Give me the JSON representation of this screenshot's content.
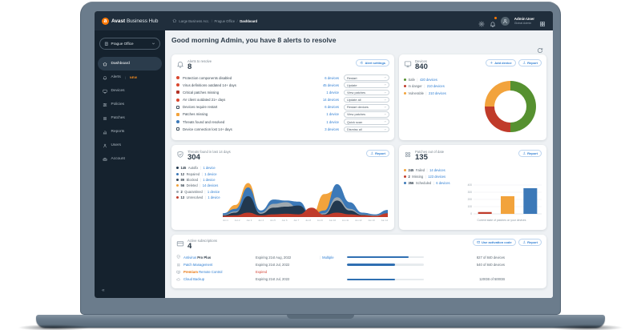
{
  "topbar": {
    "brand_bold": "Avast",
    "brand_rest": "Business Hub",
    "breadcrumb": [
      "Large Business Acc.",
      "Prague Office",
      "Dashboard"
    ],
    "user_name": "Admin User",
    "user_role": "Global Admin"
  },
  "sidebar": {
    "org": "Prague Office",
    "items": [
      {
        "label": "Dashboard",
        "icon": "home-icon",
        "active": true
      },
      {
        "label": "Alerts",
        "icon": "bell-icon",
        "badge": "NEW"
      },
      {
        "label": "Devices",
        "icon": "monitor-icon"
      },
      {
        "label": "Policies",
        "icon": "sliders-icon"
      },
      {
        "label": "Patches",
        "icon": "patch-icon"
      },
      {
        "label": "Reports",
        "icon": "report-icon"
      },
      {
        "label": "Users",
        "icon": "user-icon"
      },
      {
        "label": "Account",
        "icon": "case-icon"
      }
    ]
  },
  "main": {
    "greeting": "Good morning Admin, you have 8 alerts to resolve"
  },
  "alerts_card": {
    "title": "Alerts to resolve",
    "count": "8",
    "settings_button": "Alert settings",
    "rows": [
      {
        "label": "Protection components disabled",
        "devices": "6 devices",
        "action": "Restart",
        "icon": "circle",
        "color": "#d9472f"
      },
      {
        "label": "Virus definitions outdated 14+ days",
        "devices": "45 devices",
        "action": "Update",
        "icon": "circle",
        "color": "#d9472f"
      },
      {
        "label": "Critical patches missing",
        "devices": "1 device",
        "action": "View patches",
        "icon": "square",
        "color": "#b23327"
      },
      {
        "label": "AV client outdated 21+ days",
        "devices": "14 devices",
        "action": "Update all",
        "icon": "circle",
        "color": "#d9472f"
      },
      {
        "label": "Devices require restart",
        "devices": "6 devices",
        "action": "Restart devices",
        "icon": "outline",
        "color": "#3d4f5e"
      },
      {
        "label": "Patches missing",
        "devices": "1 device",
        "action": "View patches",
        "icon": "square",
        "color": "#f2a33c"
      },
      {
        "label": "Threats found and resolved",
        "devices": "1 device",
        "action": "Quick scan",
        "icon": "circle",
        "color": "#3c79b8"
      },
      {
        "label": "Device connection lost 14+ days",
        "devices": "3 devices",
        "action": "Dismiss all",
        "icon": "outline",
        "color": "#3d4f5e"
      }
    ]
  },
  "devices_card": {
    "title": "Devices",
    "count": "840",
    "add_button": "Add device",
    "report_button": "Report",
    "legend": [
      {
        "label": "Safe",
        "value": "420 devices",
        "color": "#569130"
      },
      {
        "label": "In danger",
        "value": "210 devices",
        "color": "#c03b2a"
      },
      {
        "label": "Vulnerable",
        "value": "210 devices",
        "color": "#f2a33c"
      }
    ]
  },
  "threats_card": {
    "title": "Threats found in last 14 days",
    "count": "304",
    "report_button": "Report",
    "legend": [
      {
        "num": "145",
        "label": "Autofix",
        "value": "1 device",
        "color": "#22384e"
      },
      {
        "num": "12",
        "label": "Repaired",
        "value": "1 device",
        "color": "#3c79b8"
      },
      {
        "num": "89",
        "label": "Blocked",
        "value": "1 device",
        "color": "#31465c"
      },
      {
        "num": "56",
        "label": "Deleted",
        "value": "14 devices",
        "color": "#f2a33c"
      },
      {
        "num": "2",
        "label": "Quarantined",
        "value": "1 device",
        "color": "#9fa9b0"
      },
      {
        "num": "13",
        "label": "Unresolved",
        "value": "1 device",
        "color": "#c03b2a"
      }
    ]
  },
  "patches_card": {
    "title": "Patches out of date",
    "count": "135",
    "report_button": "Report",
    "caption": "Current state of patches on your devices",
    "legend": [
      {
        "num": "245",
        "label": "Failed",
        "value": "14 devices",
        "color": "#f2a33c"
      },
      {
        "num": "2",
        "label": "Missing",
        "value": "123 devices",
        "color": "#c03b2a"
      },
      {
        "num": "356",
        "label": "Scheduled",
        "value": "6 devices",
        "color": "#3c79b8"
      }
    ]
  },
  "subscriptions_card": {
    "title": "Active subscriptions",
    "count": "4",
    "activation_button": "Use activation code",
    "report_button": "Report",
    "rows": [
      {
        "icon": "shield-icon",
        "name_parts": [
          {
            "text": "Antivirus ",
            "cls": "s-link"
          },
          {
            "text": "Pro Plus",
            "cls": "s-bold"
          }
        ],
        "expiry": "Expiring 21st Aug, 2022",
        "expired": false,
        "extra": "Multiple",
        "progress": 80,
        "value": "827 of 840 devices"
      },
      {
        "icon": "patch-icon",
        "name_parts": [
          {
            "text": "Patch Management",
            "cls": "s-link"
          }
        ],
        "expiry": "Expiring 21st Jul, 2022",
        "expired": false,
        "extra": "",
        "progress": 62,
        "value": "540 of 840 devices"
      },
      {
        "icon": "remote-icon",
        "name_parts": [
          {
            "text": "Premium ",
            "cls": "s-orange"
          },
          {
            "text": "Remote Control",
            "cls": "s-link"
          }
        ],
        "expiry": "Expired",
        "expired": true,
        "extra": "",
        "progress": null,
        "value": ""
      },
      {
        "icon": "cloud-icon",
        "name_parts": [
          {
            "text": "Cloud Backup",
            "cls": "s-link"
          }
        ],
        "expiry": "Expiring 21st Jul, 2022",
        "expired": false,
        "extra": "",
        "progress": 62,
        "value": "120GB of 500GB"
      }
    ]
  },
  "chart_data": [
    {
      "type": "pie",
      "subtype": "donut",
      "title": "Devices",
      "labels": [
        "Safe",
        "In danger",
        "Vulnerable"
      ],
      "values": [
        420,
        210,
        210
      ],
      "total": 840,
      "colors": [
        "#569130",
        "#c03b2a",
        "#f2a33c"
      ],
      "legend_position": "left"
    },
    {
      "type": "area",
      "title": "Threats found in last 14 days",
      "overlapping": true,
      "grid": false,
      "ylim": [
        0,
        70
      ],
      "x": [
        "Jun 1",
        "Jun 2",
        "Jun 3",
        "Jun 4",
        "Jun 5",
        "Jun 6",
        "Jun 7",
        "Jun 8",
        "Jun 9",
        "Jun 10",
        "Jun 11",
        "Jun 12",
        "Jun 13",
        "Jun 14"
      ],
      "series": [
        {
          "name": "Deleted",
          "color": "#f2a33c",
          "values": [
            5,
            22,
            62,
            10,
            16,
            24,
            26,
            3,
            42,
            50,
            14,
            6,
            4,
            9
          ]
        },
        {
          "name": "Repaired",
          "color": "#3c79b8",
          "values": [
            7,
            15,
            54,
            12,
            32,
            30,
            28,
            3,
            12,
            60,
            27,
            8,
            5,
            13
          ]
        },
        {
          "name": "Quarantined",
          "color": "#9fa9b0",
          "values": [
            4,
            10,
            32,
            8,
            24,
            27,
            16,
            2,
            7,
            36,
            15,
            5,
            3,
            6
          ]
        },
        {
          "name": "Autofix",
          "color": "#22384e",
          "values": [
            3,
            8,
            38,
            6,
            17,
            19,
            21,
            2,
            5,
            30,
            12,
            4,
            2,
            5
          ]
        },
        {
          "name": "Unresolved",
          "color": "#c03b2a",
          "values": [
            2,
            3,
            8,
            3,
            5,
            6,
            5,
            17,
            4,
            8,
            5,
            3,
            2,
            7
          ]
        }
      ],
      "legend_position": "left"
    },
    {
      "type": "bar",
      "title": "Patches out of date",
      "categories": [
        "Missing",
        "Failed",
        "Scheduled"
      ],
      "values": [
        25,
        245,
        356
      ],
      "colors": [
        "#c03b2a",
        "#f2a33c",
        "#3c79b8"
      ],
      "ylim": [
        0,
        400
      ],
      "yticks": [
        0,
        100,
        200,
        300,
        400
      ],
      "grid": true,
      "xlabel": "Current state of patches on your devices"
    }
  ]
}
